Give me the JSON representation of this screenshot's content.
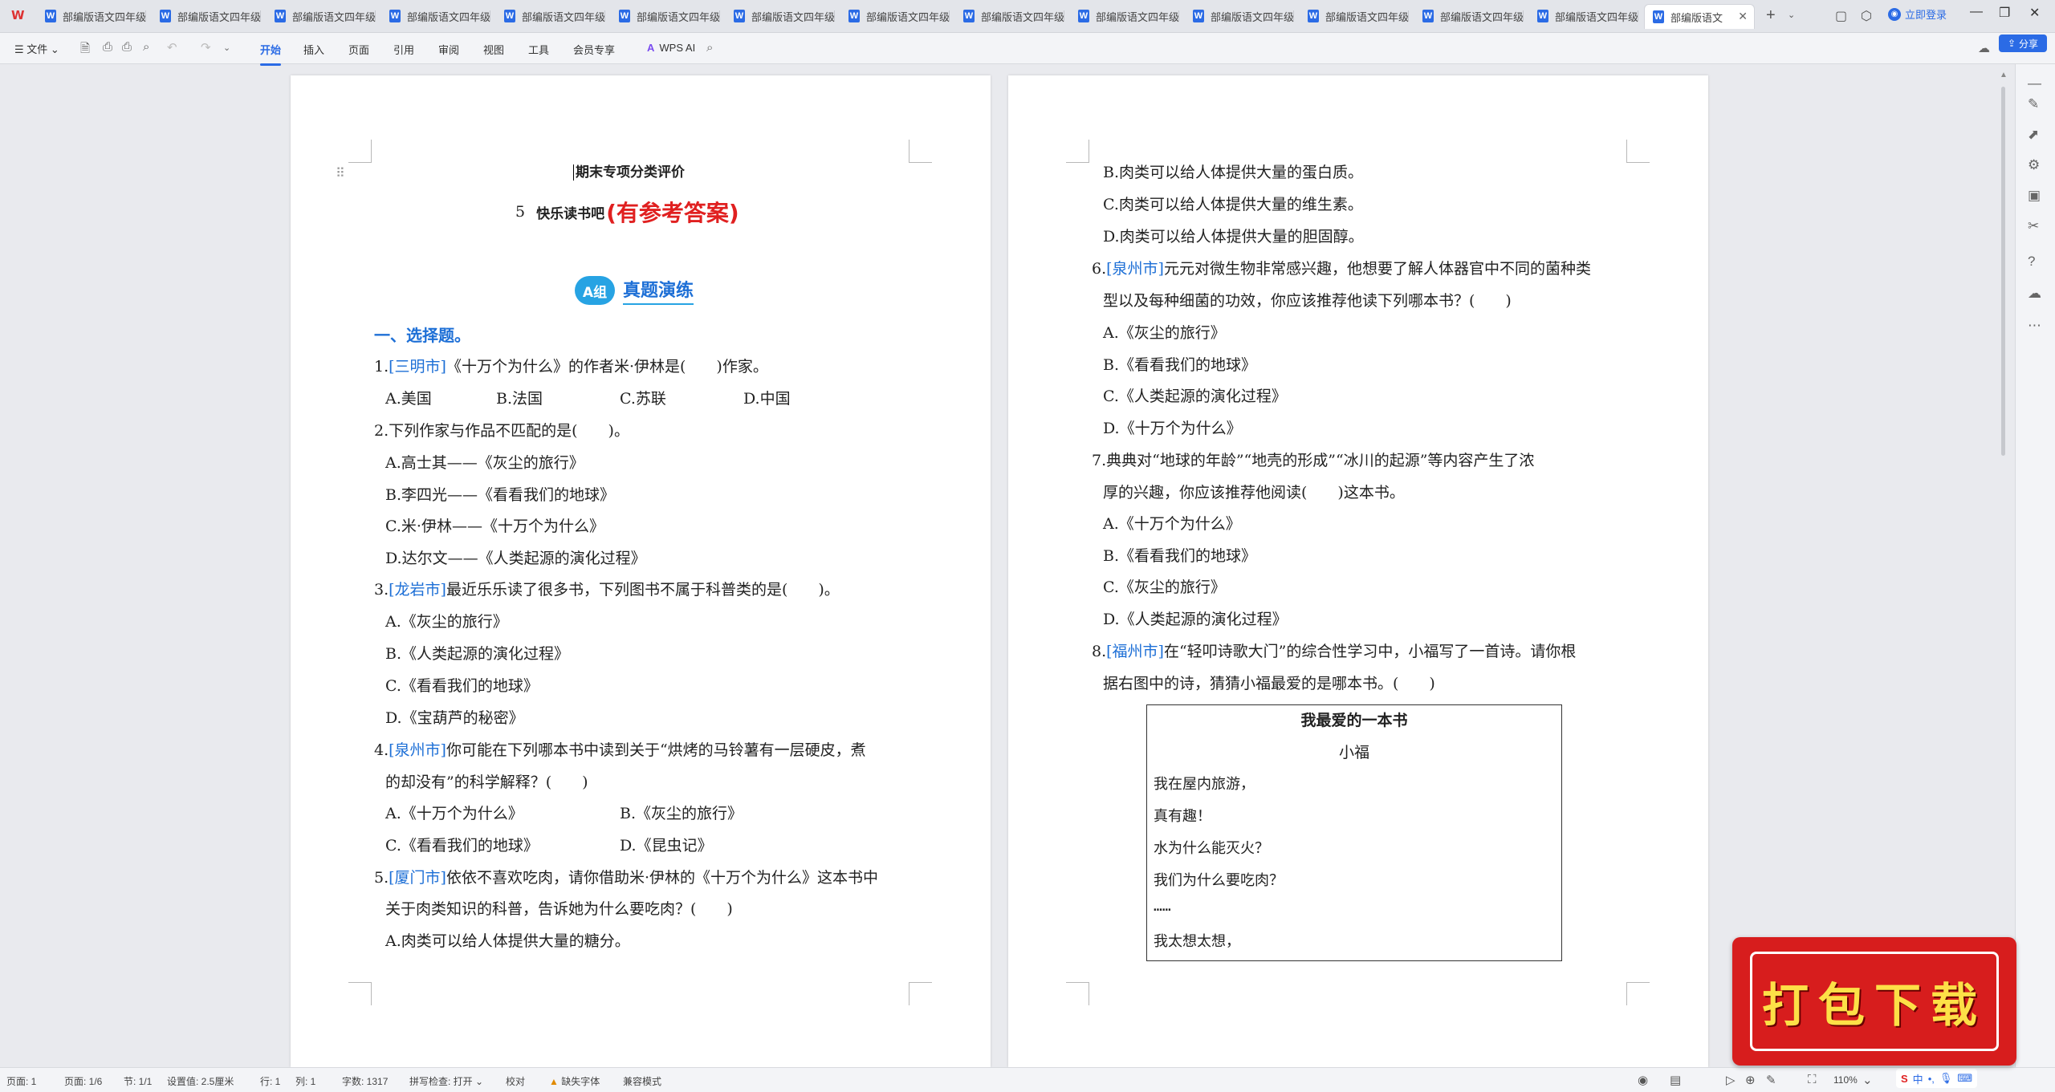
{
  "tabs": [
    {
      "title": "部编版语文四年级"
    },
    {
      "title": "部编版语文四年级"
    },
    {
      "title": "部编版语文四年级"
    },
    {
      "title": "部编版语文四年级"
    },
    {
      "title": "部编版语文四年级"
    },
    {
      "title": "部编版语文四年级"
    },
    {
      "title": "部编版语文四年级"
    },
    {
      "title": "部编版语文四年级"
    },
    {
      "title": "部编版语文四年级"
    },
    {
      "title": "部编版语文四年级"
    },
    {
      "title": "部编版语文四年级"
    },
    {
      "title": "部编版语文四年级"
    },
    {
      "title": "部编版语文四年级"
    },
    {
      "title": "部编版语文四年级"
    },
    {
      "title": "部编版语文"
    }
  ],
  "header": {
    "login": "立即登录",
    "share": "分享"
  },
  "ribbon": {
    "file": "文件",
    "menus": [
      "开始",
      "插入",
      "页面",
      "引用",
      "审阅",
      "视图",
      "工具",
      "会员专享"
    ],
    "wps_ai": "WPS AI"
  },
  "page1": {
    "title": "期末专项分类评价",
    "unit_num": "5",
    "unit_title": "快乐读书吧",
    "ref_answer": "(有参考答案)",
    "group_badge": "A组",
    "group_title": "真题演练",
    "section": "一、选择题。",
    "q1": {
      "num": "1.",
      "city": "[三明市]",
      "text": "《十万个为什么》的作者米·伊林是(　　)作家。"
    },
    "q1_opts": [
      "A.美国",
      "B.法国",
      "C.苏联",
      "D.中国"
    ],
    "q2": {
      "text": "2.下列作家与作品不匹配的是(　　)。"
    },
    "q2_opts": [
      "A.高士其——《灰尘的旅行》",
      "B.李四光——《看看我们的地球》",
      "C.米·伊林——《十万个为什么》",
      "D.达尔文——《人类起源的演化过程》"
    ],
    "q3": {
      "num": "3.",
      "city": "[龙岩市]",
      "text": "最近乐乐读了很多书，下列图书不属于科普类的是(　　)。"
    },
    "q3_opts": [
      "A.《灰尘的旅行》",
      "B.《人类起源的演化过程》",
      "C.《看看我们的地球》",
      "D.《宝葫芦的秘密》"
    ],
    "q4": {
      "num": "4.",
      "city": "[泉州市]",
      "text": "你可能在下列哪本书中读到关于“烘烤的马铃薯有一层硬皮，煮",
      "text2": "的却没有”的科学解释？(　　)"
    },
    "q4_opts": [
      "A.《十万个为什么》",
      "B.《灰尘的旅行》",
      "C.《看看我们的地球》",
      "D.《昆虫记》"
    ],
    "q5": {
      "num": "5.",
      "city": "[厦门市]",
      "text": "依依不喜欢吃肉，请你借助米·伊林的《十万个为什么》这本书中",
      "text2": "关于肉类知识的科普，告诉她为什么要吃肉？(　　)"
    },
    "q5_optA": "A.肉类可以给人体提供大量的糖分。"
  },
  "page2": {
    "q5_opts": [
      "B.肉类可以给人体提供大量的蛋白质。",
      "C.肉类可以给人体提供大量的维生素。",
      "D.肉类可以给人体提供大量的胆固醇。"
    ],
    "q6": {
      "num": "6.",
      "city": "[泉州市]",
      "text": "元元对微生物非常感兴趣，他想要了解人体器官中不同的菌种类",
      "text2": "型以及每种细菌的功效，你应该推荐他读下列哪本书？(　　)"
    },
    "q6_opts": [
      "A.《灰尘的旅行》",
      "B.《看看我们的地球》",
      "C.《人类起源的演化过程》",
      "D.《十万个为什么》"
    ],
    "q7": {
      "text": "7.典典对“地球的年龄”“地壳的形成”“冰川的起源”等内容产生了浓",
      "text2": "厚的兴趣，你应该推荐他阅读(　　)这本书。"
    },
    "q7_opts": [
      "A.《十万个为什么》",
      "B.《看看我们的地球》",
      "C.《灰尘的旅行》",
      "D.《人类起源的演化过程》"
    ],
    "q8": {
      "num": "8.",
      "city": "[福州市]",
      "text": "在“轻叩诗歌大门”的综合性学习中，小福写了一首诗。请你根",
      "text2": "据右图中的诗，猜猜小福最爱的是哪本书。(　　)"
    },
    "poem": {
      "title": "我最爱的一本书",
      "author": "小福",
      "lines": [
        "我在屋内旅游，",
        "真有趣！",
        "水为什么能灭火？",
        "我们为什么要吃肉？",
        "……",
        "我太想太想，"
      ]
    }
  },
  "status": {
    "page": "页面: 1",
    "pages": "页面: 1/6",
    "section": "节: 1/1",
    "setting": "设置值: 2.5厘米",
    "row": "行: 1",
    "col": "列: 1",
    "words": "字数: 1317",
    "spell": "拼写检查: 打开",
    "proof": "校对",
    "missing_font": "缺失字体",
    "compat": "兼容模式",
    "zoom": "110%"
  },
  "download_badge": "打包下载",
  "ime": {
    "lang": "中"
  }
}
